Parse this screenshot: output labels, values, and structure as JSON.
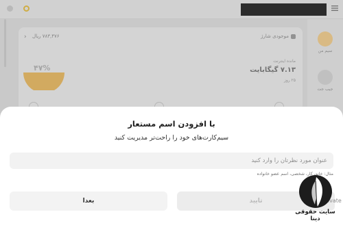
{
  "background": {
    "plan_name": "موجودی شارژ",
    "balance_text": "۷۸۳,۴۷۶ ریال",
    "internet_left_label": "مانده اینترنت",
    "internet_left_value": "۷.۱۳ گیگابایت",
    "internet_days_left": "۲۵ روز",
    "usage_percent_label": "۴۷%",
    "usage_percent": 0.47,
    "rail_items": [
      {
        "label": "سیم من",
        "active": true
      },
      {
        "label": "جیب جت",
        "active": false
      }
    ]
  },
  "sheet": {
    "title": "با افزودن اسم مستعار",
    "subtitle": "سیم‌کارت‌های خود را راحت‌تر مدیریت کنید",
    "alias_input": {
      "placeholder": "عنوان مورد نظرتان را وارد کنید",
      "value": ""
    },
    "hint": "مثال: خانه، کار، شخصی، اسم عضو خانواده",
    "confirm_label": "تایید",
    "later_label": "بعدا"
  },
  "system_overlay": {
    "activate_text": "Activate"
  },
  "watermark": {
    "text": "سایت حقوقی دینا"
  },
  "colors": {
    "accent": "#f5b43c",
    "sheet_bg": "#ffffff",
    "input_bg": "#f2f2f2",
    "button_disabled_text": "#b9b9b9"
  }
}
